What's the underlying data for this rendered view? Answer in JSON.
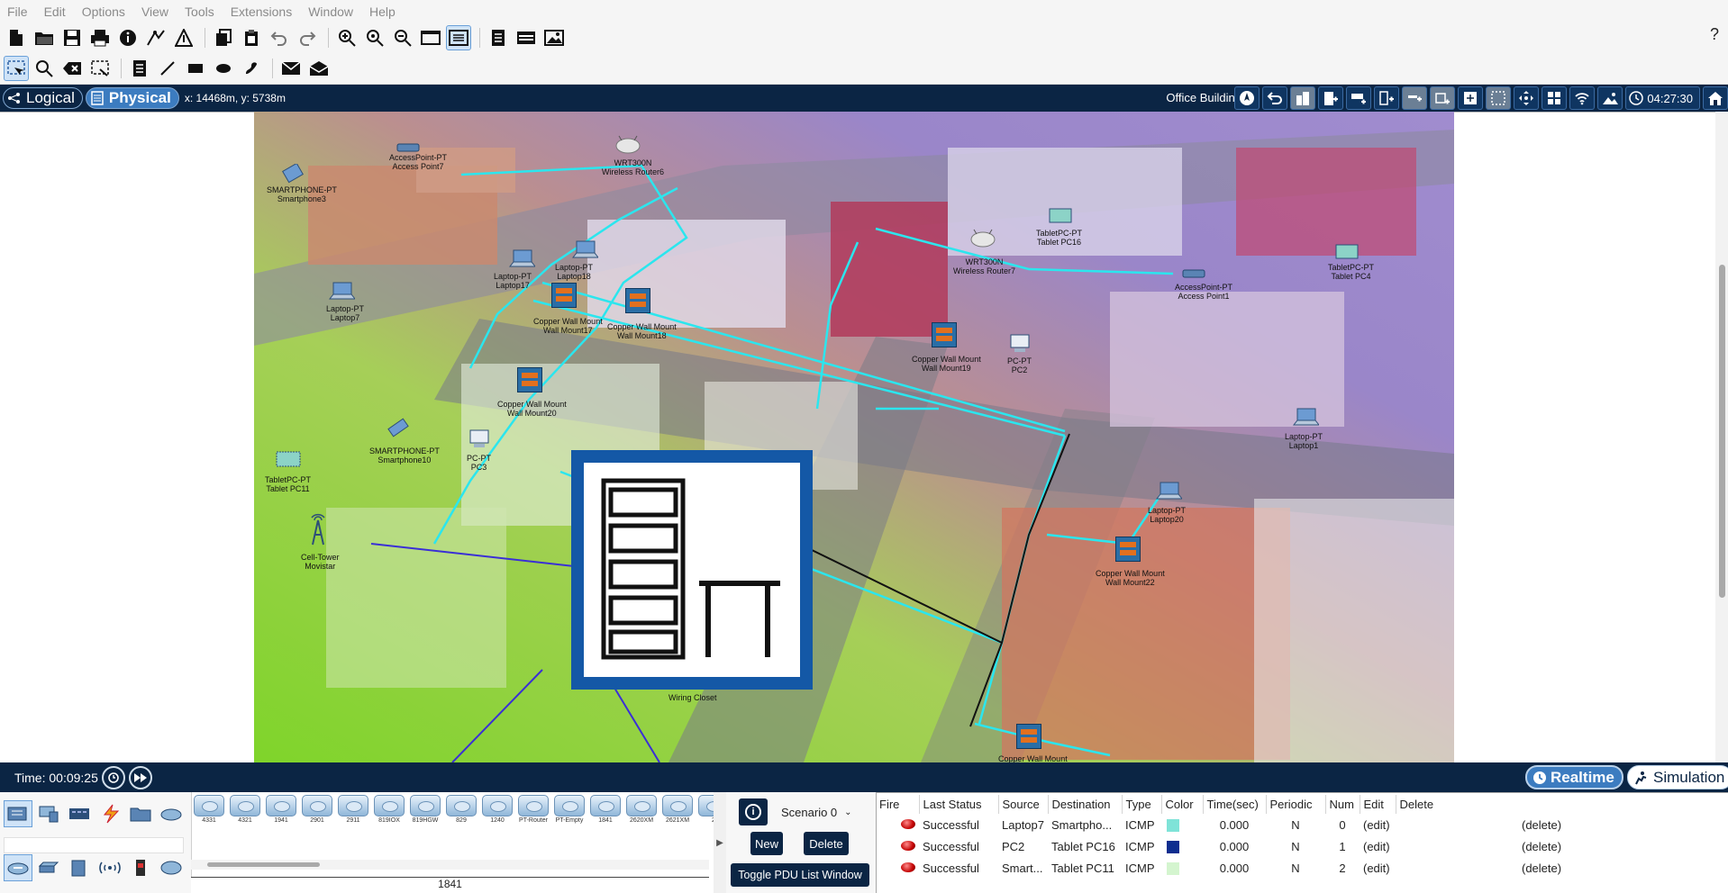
{
  "menu": [
    "File",
    "Edit",
    "Options",
    "View",
    "Tools",
    "Extensions",
    "Window",
    "Help"
  ],
  "workspace": {
    "logical_label": "Logical",
    "physical_label": "Physical",
    "coords": "x: 14468m, y: 5738m",
    "location": "Office Building",
    "clock": "04:27:30"
  },
  "map_labels": {
    "ap7": "AccessPoint-PT\nAccess Point7",
    "router6": "WRT300N\nWireless Router6",
    "smartphone3": "SMARTPHONE-PT\nSmartphone3",
    "laptop7": "Laptop-PT\nLaptop7",
    "laptop17": "Laptop-PT\nLaptop17",
    "laptop18": "Laptop-PT\nLaptop18",
    "wm17": "Copper Wall Mount\nWall Mount17",
    "wm18": "Copper Wall Mount\nWall Mount18",
    "wm20": "Copper Wall Mount\nWall Mount20",
    "router7": "WRT300N\nWireless Router7",
    "tabletpc16": "TabletPC-PT\nTablet PC16",
    "ap1": "AccessPoint-PT\nAccess Point1",
    "tabletpc4": "TabletPC-PT\nTablet PC4",
    "wm19": "Copper Wall Mount\nWall Mount19",
    "pc2": "PC-PT\nPC2",
    "smartphone10": "SMARTPHONE-PT\nSmartphone10",
    "pc3": "PC-PT\nPC3",
    "tabletpc11": "TabletPC-PT\nTablet PC11",
    "laptop1": "Laptop-PT\nLaptop1",
    "laptop20": "Laptop-PT\nLaptop20",
    "wm22": "Copper Wall Mount\nWall Mount22",
    "celltower": "Cell-Tower\nMovistar",
    "wiring_closet": "Wiring Closet",
    "wm_bottom": "Copper Wall Mount"
  },
  "bottom": {
    "time": "Time: 00:09:25",
    "realtime": "Realtime",
    "simulation": "Simulation"
  },
  "models": [
    "4331",
    "4321",
    "1941",
    "2901",
    "2911",
    "819IOX",
    "819HGW",
    "829",
    "1240",
    "PT-Router",
    "PT-Empty",
    "1841",
    "2620XM",
    "2621XM",
    "2"
  ],
  "selected_model": "1841",
  "scenario": {
    "selected": "Scenario 0",
    "new_label": "New",
    "delete_label": "Delete",
    "toggle_label": "Toggle PDU List Window"
  },
  "pdu_table": {
    "headers": [
      "Fire",
      "Last Status",
      "Source",
      "Destination",
      "Type",
      "Color",
      "Time(sec)",
      "Periodic",
      "Num",
      "Edit",
      "Delete"
    ],
    "rows": [
      {
        "status": "Successful",
        "source": "Laptop7",
        "destination": "Smartpho...",
        "type": "ICMP",
        "color": "#7fe3d8",
        "time": "0.000",
        "periodic": "N",
        "num": "0",
        "edit": "(edit)",
        "delete": "(delete)"
      },
      {
        "status": "Successful",
        "source": "PC2",
        "destination": "Tablet PC16",
        "type": "ICMP",
        "color": "#0d2d8f",
        "time": "0.000",
        "periodic": "N",
        "num": "1",
        "edit": "(edit)",
        "delete": "(delete)"
      },
      {
        "status": "Successful",
        "source": "Smart...",
        "destination": "Tablet PC11",
        "type": "ICMP",
        "color": "#d4f5cf",
        "time": "0.000",
        "periodic": "N",
        "num": "2",
        "edit": "(edit)",
        "delete": "(delete)"
      }
    ]
  },
  "icons": {
    "help": "?"
  }
}
